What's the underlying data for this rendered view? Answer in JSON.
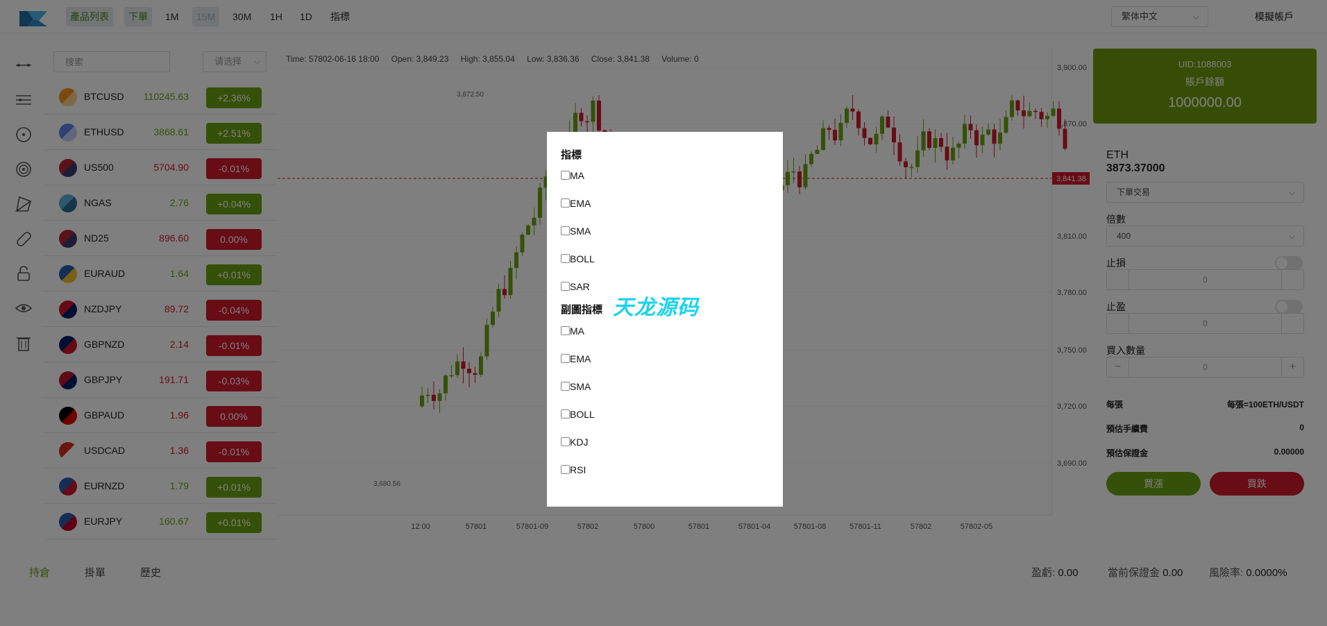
{
  "topbar": {
    "nav": [
      {
        "label": "產品列表",
        "name": "nav-product-list"
      },
      {
        "label": "下單",
        "name": "nav-order"
      },
      {
        "label": "1M",
        "name": "nav-1m"
      },
      {
        "label": "15M",
        "name": "nav-15m"
      },
      {
        "label": "30M",
        "name": "nav-30m"
      },
      {
        "label": "1H",
        "name": "nav-1h"
      },
      {
        "label": "1D",
        "name": "nav-1d"
      },
      {
        "label": "指標",
        "name": "nav-indicators"
      }
    ],
    "language": "繁体中文",
    "demo_account": "模擬帳戶"
  },
  "rail_icons": [
    "line-tool-icon",
    "hline-tool-icon",
    "crosshair-icon",
    "target-icon",
    "network-icon",
    "magnet-icon",
    "lock-icon",
    "eye-icon",
    "trash-icon"
  ],
  "product_panel": {
    "search_placeholder": "搜索",
    "filter_placeholder": "请选择",
    "products": [
      {
        "symbol": "BTCUSD",
        "price": "110245.63",
        "change": "+2.36%",
        "dir": "up"
      },
      {
        "symbol": "ETHUSD",
        "price": "3868.61",
        "change": "+2.51%",
        "dir": "up"
      },
      {
        "symbol": "US500",
        "price": "5704.90",
        "change": "-0.01%",
        "dir": "down"
      },
      {
        "symbol": "NGAS",
        "price": "2.76",
        "change": "+0.04%",
        "dir": "up"
      },
      {
        "symbol": "ND25",
        "price": "896.60",
        "change": "0.00%",
        "dir": "down"
      },
      {
        "symbol": "EURAUD",
        "price": "1.64",
        "change": "+0.01%",
        "dir": "up"
      },
      {
        "symbol": "NZDJPY",
        "price": "89.72",
        "change": "-0.04%",
        "dir": "down"
      },
      {
        "symbol": "GBPNZD",
        "price": "2.14",
        "change": "-0.01%",
        "dir": "down"
      },
      {
        "symbol": "GBPJPY",
        "price": "191.71",
        "change": "-0.03%",
        "dir": "down"
      },
      {
        "symbol": "GBPAUD",
        "price": "1.96",
        "change": "0.00%",
        "dir": "down"
      },
      {
        "symbol": "USDCAD",
        "price": "1.36",
        "change": "-0.01%",
        "dir": "down"
      },
      {
        "symbol": "EURNZD",
        "price": "1.79",
        "change": "+0.01%",
        "dir": "up"
      },
      {
        "symbol": "EURJPY",
        "price": "160.67",
        "change": "+0.01%",
        "dir": "up"
      }
    ]
  },
  "chart": {
    "info": {
      "time": "Time: 57802-06-16 18:00",
      "open": "Open: 3,849.23",
      "high": "High: 3,855.04",
      "low": "Low: 3,836.36",
      "close": "Close: 3,841.38",
      "volume": "Volume: 0"
    },
    "price_ticks": [
      "3,900.00",
      "3,870.00",
      "3,810.00",
      "3,780.00",
      "3,750.00",
      "3,720.00",
      "3,690.00"
    ],
    "time_ticks": [
      "12:00",
      "57801",
      "57801-09",
      "57802",
      "57800",
      "57801",
      "57801-04",
      "57801-08",
      "57801-11",
      "57802",
      "57802-05"
    ],
    "last_price_label": "3,841.38",
    "high_marker": "3,872.50",
    "low_marker": "3,680.56",
    "colors": {
      "up": "#6aa312",
      "down": "#d0192b"
    }
  },
  "order_panel": {
    "uid": "UID:1088003",
    "balance_label": "賬戶餘額",
    "balance": "1000000.00",
    "symbol": "ETH",
    "symbol_price": "3873.37000",
    "order_type": "下單交易",
    "multiplier_label": "倍數",
    "multiplier": "400",
    "stop_loss_label": "止損",
    "stop_loss_value": "0",
    "take_profit_label": "止盈",
    "take_profit_value": "0",
    "buy_qty_label": "買入數量",
    "buy_qty_value": "0",
    "rows": [
      {
        "label": "每張",
        "value": "每張=100ETH/USDT"
      },
      {
        "label": "預估手續費",
        "value": "0"
      },
      {
        "label": "預估保證金",
        "value": "0.00000"
      }
    ],
    "buy_up": "買漲",
    "buy_down": "買跌",
    "colors": {
      "accent": "#6e9a0c",
      "buy": "#6aa312",
      "sell": "#d0192b"
    }
  },
  "bottom": {
    "tabs": [
      "持倉",
      "掛單",
      "歷史"
    ],
    "pnl_label": "盈虧:",
    "pnl": "0.00",
    "margin_label": "當前保證金",
    "margin": "0.00",
    "risk_label": "風險率:",
    "risk": "0.0000%"
  },
  "modal": {
    "main_title": "指標",
    "main_options": [
      "MA",
      "EMA",
      "SMA",
      "BOLL",
      "SAR"
    ],
    "sub_title": "副圖指標",
    "sub_options": [
      "MA",
      "EMA",
      "SMA",
      "BOLL",
      "KDJ",
      "RSI"
    ],
    "watermark": "天龙源码"
  }
}
